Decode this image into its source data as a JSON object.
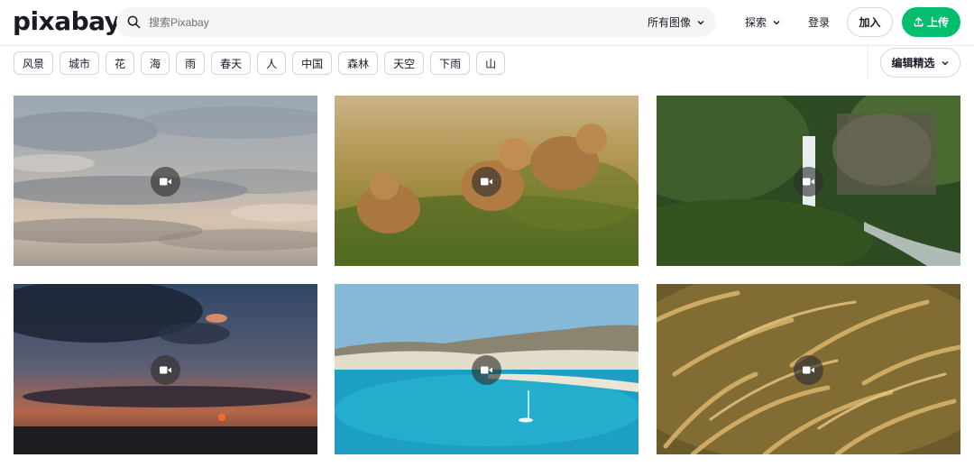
{
  "header": {
    "logo": "pixabay",
    "search": {
      "placeholder": "搜索Pixabay",
      "type_label": "所有图像"
    },
    "explore_label": "探索",
    "login_label": "登录",
    "join_label": "加入",
    "upload_label": "上传"
  },
  "tags": [
    "风景",
    "城市",
    "花",
    "海",
    "雨",
    "春天",
    "人",
    "中国",
    "森林",
    "天空",
    "下雨",
    "山"
  ],
  "sort": {
    "label": "编辑精选"
  },
  "results": [
    {
      "kind": "video",
      "icon": "video-camera-icon",
      "subject": "clouds"
    },
    {
      "kind": "video",
      "icon": "video-camera-icon",
      "subject": "lions"
    },
    {
      "kind": "video",
      "icon": "video-camera-icon",
      "subject": "waterfall"
    },
    {
      "kind": "video",
      "icon": "video-camera-icon",
      "subject": "sunset"
    },
    {
      "kind": "video",
      "icon": "video-camera-icon",
      "subject": "bay"
    },
    {
      "kind": "video",
      "icon": "video-camera-icon",
      "subject": "grass"
    }
  ],
  "colors": {
    "brand_green": "#02be6e",
    "text": "#191b26",
    "border": "#d6d6d6",
    "search_bg": "#f5f5f5"
  }
}
